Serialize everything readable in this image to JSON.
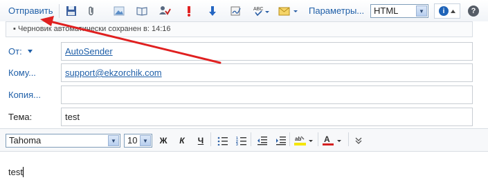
{
  "toolbar": {
    "send_label": "Отправить",
    "params_label": "Параметры...",
    "format_value": "HTML",
    "info_icon": "i",
    "help_icon": "?"
  },
  "draft": {
    "text": "Черновик автоматически сохранен в: 14:16"
  },
  "fields": {
    "from_label": "От:",
    "from_value": "AutoSender",
    "to_label": "Кому...",
    "to_value": "support@ekzorchik.com",
    "cc_label": "Копия...",
    "cc_value": "",
    "subject_label": "Тема:",
    "subject_value": "test"
  },
  "formatting": {
    "font_value": "Tahoma",
    "size_value": "10",
    "bold": "Ж",
    "italic": "К",
    "underline": "Ч"
  },
  "body": {
    "text": "test"
  },
  "colors": {
    "link_blue": "#1f5fa8",
    "annotation_arrow": "#e02020",
    "highlight_yellow": "#f5e600",
    "font_color_red": "#d42020"
  }
}
